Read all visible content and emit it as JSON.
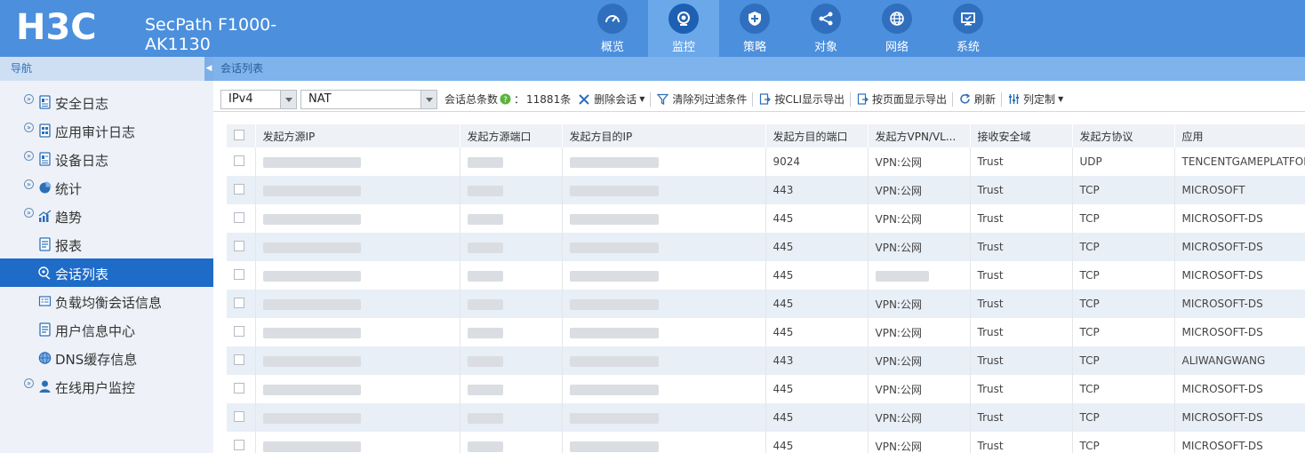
{
  "header": {
    "logo_text": "H3C",
    "product_name": "SecPath F1000-AK1130",
    "nav": [
      {
        "label": "概览",
        "icon": "dashboard-icon"
      },
      {
        "label": "监控",
        "icon": "camera-icon",
        "active": true
      },
      {
        "label": "策略",
        "icon": "shield-icon"
      },
      {
        "label": "对象",
        "icon": "share-icon"
      },
      {
        "label": "网络",
        "icon": "globe-icon"
      },
      {
        "label": "系统",
        "icon": "monitor-icon"
      }
    ]
  },
  "sidebar": {
    "title": "导航",
    "items": [
      {
        "label": "安全日志",
        "expandable": true,
        "icon": "log-icon"
      },
      {
        "label": "应用审计日志",
        "expandable": true,
        "icon": "audit-log-icon"
      },
      {
        "label": "设备日志",
        "expandable": true,
        "icon": "device-log-icon"
      },
      {
        "label": "统计",
        "expandable": true,
        "icon": "pie-chart-icon"
      },
      {
        "label": "趋势",
        "expandable": true,
        "icon": "trend-icon"
      },
      {
        "label": "报表",
        "expandable": false,
        "icon": "report-icon"
      },
      {
        "label": "会话列表",
        "expandable": false,
        "icon": "session-icon",
        "active": true
      },
      {
        "label": "负载均衡会话信息",
        "expandable": false,
        "icon": "load-balance-icon"
      },
      {
        "label": "用户信息中心",
        "expandable": false,
        "icon": "user-info-icon"
      },
      {
        "label": "DNS缓存信息",
        "expandable": false,
        "icon": "dns-globe-icon"
      },
      {
        "label": "在线用户监控",
        "expandable": true,
        "icon": "online-user-icon"
      }
    ]
  },
  "main": {
    "tab_title": "会话列表",
    "toolbar": {
      "ip_version": "IPv4",
      "session_type": "NAT",
      "total_label": "会话总条数",
      "total_value": "11881条",
      "delete_label": "删除会话",
      "clear_filter_label": "清除列过滤条件",
      "export_cli_label": "按CLI显示导出",
      "export_page_label": "按页面显示导出",
      "refresh_label": "刷新",
      "customize_label": "列定制"
    },
    "table": {
      "columns": [
        "发起方源IP",
        "发起方源端口",
        "发起方目的IP",
        "发起方目的端口",
        "发起方VPN/VL...",
        "接收安全域",
        "发起方协议",
        "应用"
      ],
      "rows": [
        {
          "dst_port": "9024",
          "vpn": "VPN:公网",
          "zone": "Trust",
          "proto": "UDP",
          "app": "TENCENTGAMEPLATFORM"
        },
        {
          "dst_port": "443",
          "vpn": "VPN:公网",
          "zone": "Trust",
          "proto": "TCP",
          "app": "MICROSOFT"
        },
        {
          "dst_port": "445",
          "vpn": "VPN:公网",
          "zone": "Trust",
          "proto": "TCP",
          "app": "MICROSOFT-DS"
        },
        {
          "dst_port": "445",
          "vpn": "VPN:公网",
          "zone": "Trust",
          "proto": "TCP",
          "app": "MICROSOFT-DS"
        },
        {
          "dst_port": "445",
          "vpn": "",
          "zone": "Trust",
          "proto": "TCP",
          "app": "MICROSOFT-DS"
        },
        {
          "dst_port": "445",
          "vpn": "VPN:公网",
          "zone": "Trust",
          "proto": "TCP",
          "app": "MICROSOFT-DS"
        },
        {
          "dst_port": "445",
          "vpn": "VPN:公网",
          "zone": "Trust",
          "proto": "TCP",
          "app": "MICROSOFT-DS"
        },
        {
          "dst_port": "443",
          "vpn": "VPN:公网",
          "zone": "Trust",
          "proto": "TCP",
          "app": "ALIWANGWANG"
        },
        {
          "dst_port": "445",
          "vpn": "VPN:公网",
          "zone": "Trust",
          "proto": "TCP",
          "app": "MICROSOFT-DS"
        },
        {
          "dst_port": "445",
          "vpn": "VPN:公网",
          "zone": "Trust",
          "proto": "TCP",
          "app": "MICROSOFT-DS"
        },
        {
          "dst_port": "445",
          "vpn": "VPN:公网",
          "zone": "Trust",
          "proto": "TCP",
          "app": "MICROSOFT-DS"
        }
      ]
    }
  },
  "colors": {
    "header_bg": "#4b8fdd",
    "nav_active_bg": "#6aa8ea",
    "sidebar_active_bg": "#1e6bc8",
    "row_alt_bg": "#e9eff7"
  }
}
